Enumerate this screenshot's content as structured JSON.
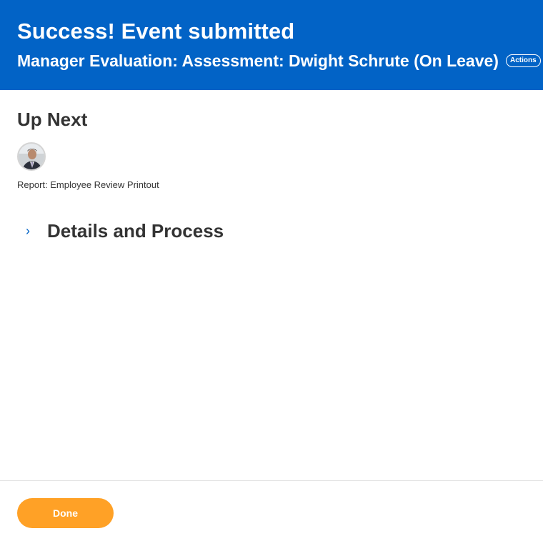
{
  "banner": {
    "title": "Success! Event submitted",
    "subtitle": "Manager Evaluation: Assessment: Dwight Schrute (On Leave)",
    "actions_label": "Actions",
    "background_color": "#0263c6"
  },
  "up_next": {
    "heading": "Up Next",
    "avatar_icon": "person-photo",
    "report_label": "Report: Employee Review Printout"
  },
  "details": {
    "chevron_icon": "chevron-right-icon",
    "title": "Details and Process"
  },
  "footer": {
    "done_label": "Done",
    "done_color": "#ffa126"
  }
}
